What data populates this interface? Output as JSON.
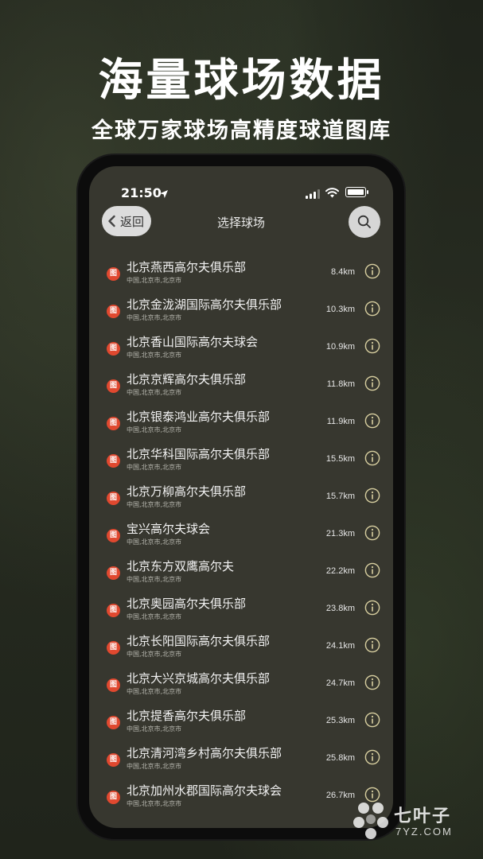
{
  "headline": "海量球场数据",
  "subheadline": "全球万家球场高精度球道图库",
  "status_bar": {
    "time": "21:50",
    "battery_level": 0.9
  },
  "nav": {
    "back_label": "返回",
    "title": "选择球场"
  },
  "icons": {
    "location_arrow": "location-arrow-icon",
    "signal": "signal-icon",
    "wifi": "wifi-icon",
    "battery": "battery-icon",
    "back": "chevron-left-icon",
    "search": "search-icon",
    "course": "course-map-icon",
    "info": "info-icon"
  },
  "badge_glyph": "图",
  "colors": {
    "badge": "#e0482f",
    "info_icon": "#d8cfa0",
    "screen_bg": "#37372f"
  },
  "courses": [
    {
      "name": "北京燕西高尔夫俱乐部",
      "location": "中国,北京市,北京市",
      "distance": "8.4km"
    },
    {
      "name": "北京金泷湖国际高尔夫俱乐部",
      "location": "中国,北京市,北京市",
      "distance": "10.3km"
    },
    {
      "name": "北京香山国际高尔夫球会",
      "location": "中国,北京市,北京市",
      "distance": "10.9km"
    },
    {
      "name": "北京京辉高尔夫俱乐部",
      "location": "中国,北京市,北京市",
      "distance": "11.8km"
    },
    {
      "name": "北京银泰鸿业高尔夫俱乐部",
      "location": "中国,北京市,北京市",
      "distance": "11.9km"
    },
    {
      "name": "北京华科国际高尔夫俱乐部",
      "location": "中国,北京市,北京市",
      "distance": "15.5km"
    },
    {
      "name": "北京万柳高尔夫俱乐部",
      "location": "中国,北京市,北京市",
      "distance": "15.7km"
    },
    {
      "name": "宝兴高尔夫球会",
      "location": "中国,北京市,北京市",
      "distance": "21.3km"
    },
    {
      "name": "北京东方双鹰高尔夫",
      "location": "中国,北京市,北京市",
      "distance": "22.2km"
    },
    {
      "name": "北京奥园高尔夫俱乐部",
      "location": "中国,北京市,北京市",
      "distance": "23.8km"
    },
    {
      "name": "北京长阳国际高尔夫俱乐部",
      "location": "中国,北京市,北京市",
      "distance": "24.1km"
    },
    {
      "name": "北京大兴京城高尔夫俱乐部",
      "location": "中国,北京市,北京市",
      "distance": "24.7km"
    },
    {
      "name": "北京提香高尔夫俱乐部",
      "location": "中国,北京市,北京市",
      "distance": "25.3km"
    },
    {
      "name": "北京清河湾乡村高尔夫俱乐部",
      "location": "中国,北京市,北京市",
      "distance": "25.8km"
    },
    {
      "name": "北京加州水郡国际高尔夫球会",
      "location": "中国,北京市,北京市",
      "distance": "26.7km"
    }
  ],
  "watermark": {
    "text": "七叶子",
    "sub": "7YZ.COM"
  }
}
